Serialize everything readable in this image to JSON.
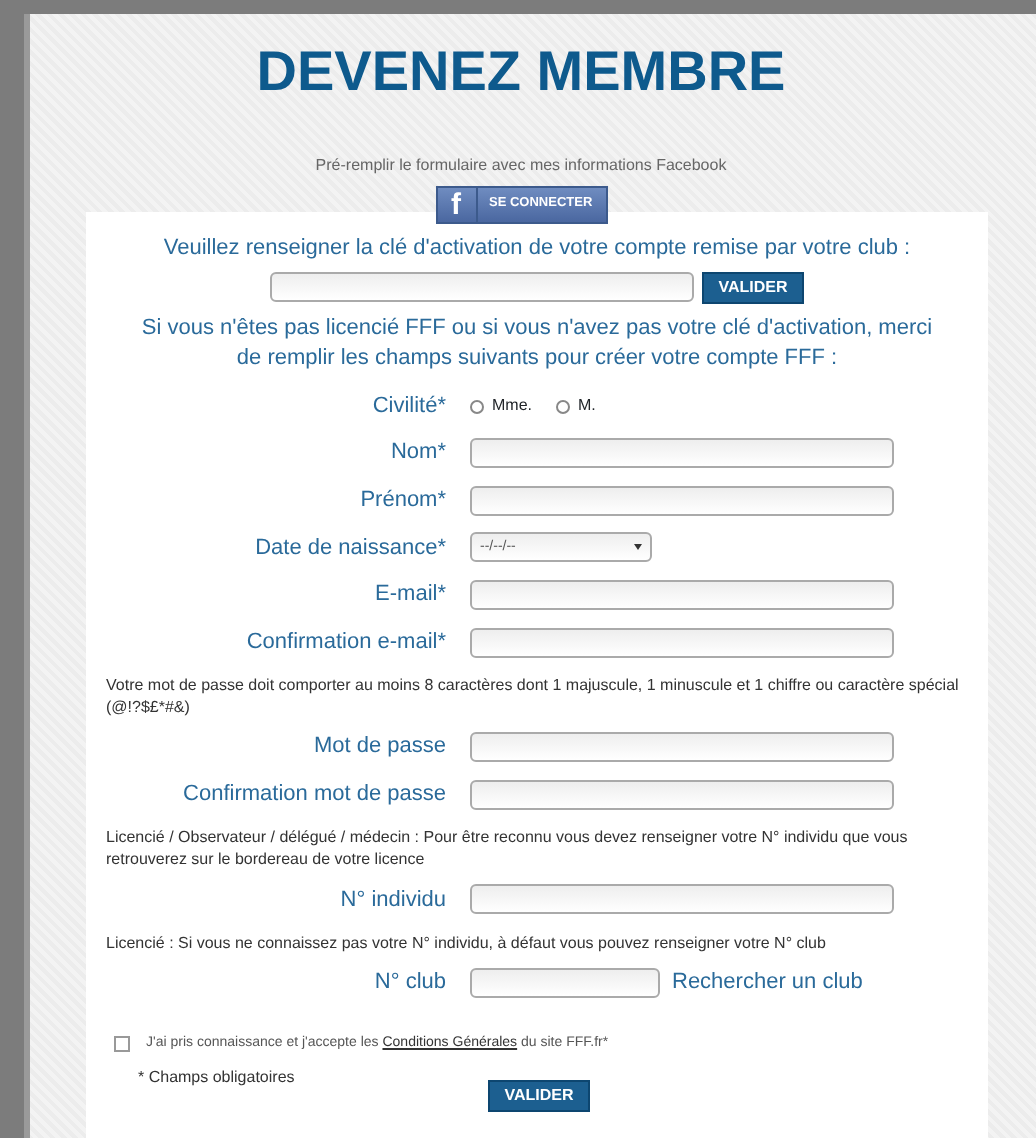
{
  "title": "DEVENEZ MEMBRE",
  "facebook": {
    "prompt": "Pré-remplir le formulaire avec mes informations Facebook",
    "icon": "f",
    "button": "SE CONNECTER"
  },
  "activation": {
    "prompt": "Veuillez renseigner la clé d'activation de votre compte remise par votre club :",
    "button": "VALIDER"
  },
  "intro": "Si vous n'êtes pas licencié FFF ou si vous n'avez pas votre clé d'activation, merci de remplir les champs suivants pour créer votre compte FFF :",
  "rows": [
    {
      "kind": "radio",
      "label": "Civilité*",
      "options": [
        {
          "label": "Mme.",
          "selected": false
        },
        {
          "label": "M.",
          "selected": false
        }
      ]
    },
    {
      "kind": "text",
      "label": "Nom*"
    },
    {
      "kind": "text",
      "label": "Prénom*"
    },
    {
      "kind": "date",
      "label": "Date de naissance*",
      "value": "--/--/--"
    },
    {
      "kind": "text",
      "label": "E-mail*"
    },
    {
      "kind": "text",
      "label": "Confirmation e-mail*"
    },
    {
      "kind": "note",
      "text": "Votre mot de passe doit comporter au moins 8 caractères dont 1 majuscule, 1 minuscule et 1 chiffre ou caractère spécial (@!?$£*#&)"
    },
    {
      "kind": "password",
      "label": "Mot de passe"
    },
    {
      "kind": "password",
      "label": "Confirmation mot de passe"
    },
    {
      "kind": "note",
      "text": "Licencié / Observateur / délégué / médecin : Pour être reconnu vous devez renseigner votre N° individu que vous retrouverez sur le bordereau de votre licence"
    },
    {
      "kind": "text",
      "label": "N° individu"
    },
    {
      "kind": "note",
      "text": "Licencié : Si vous ne connaissez pas votre N° individu, à défaut vous pouvez renseigner votre N° club"
    },
    {
      "kind": "club",
      "label": "N° club",
      "link": "Rechercher un club"
    }
  ],
  "terms": {
    "checked": false,
    "before": "J'ai pris connaissance et j'accepte les ",
    "link": "Conditions Générales",
    "after": " du site FFF.fr*"
  },
  "required_note": "* Champs obligatoires",
  "submit": "VALIDER"
}
